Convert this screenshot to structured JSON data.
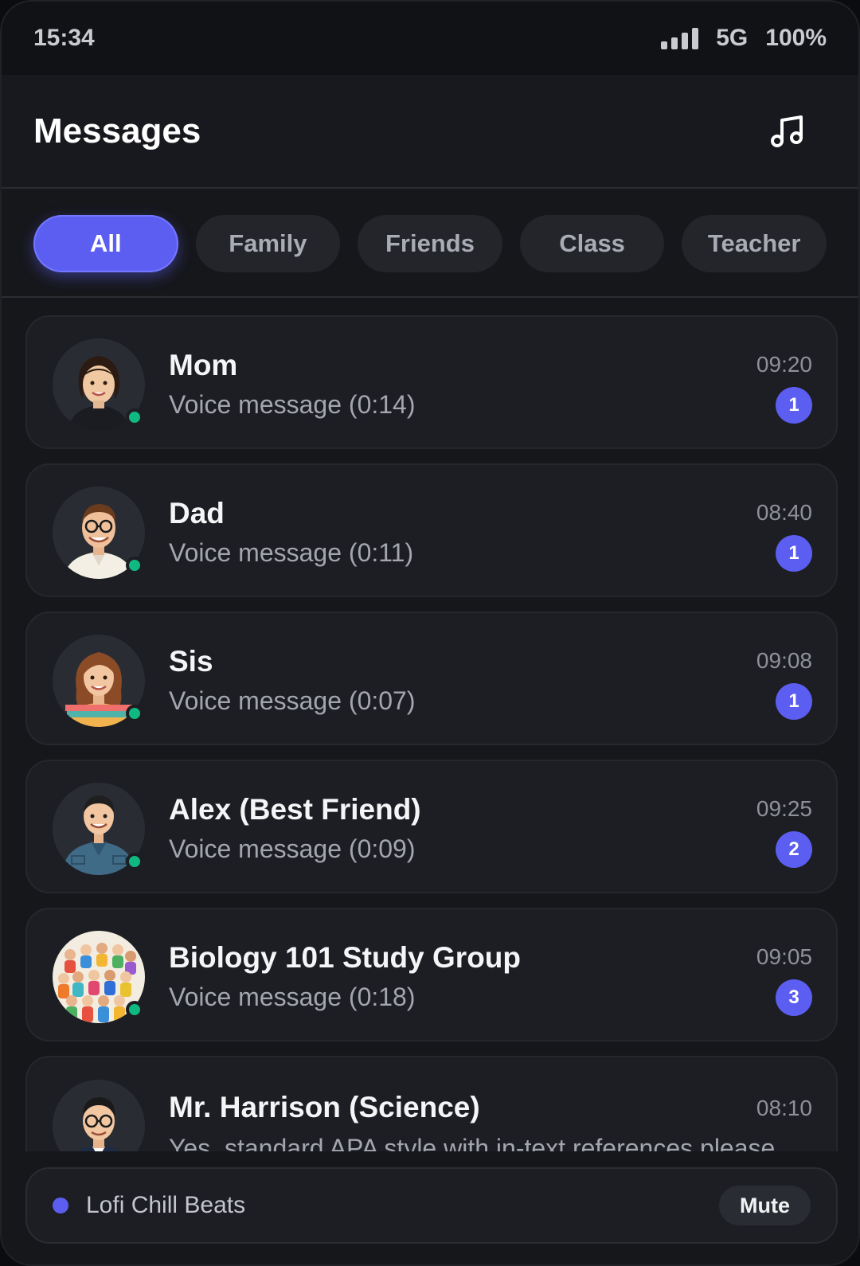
{
  "status": {
    "time": "15:34",
    "network": "5G",
    "battery": "100%"
  },
  "header": {
    "title": "Messages",
    "music_icon": "music-note-icon"
  },
  "tabs": [
    {
      "label": "All",
      "active": true
    },
    {
      "label": "Family",
      "active": false
    },
    {
      "label": "Friends",
      "active": false
    },
    {
      "label": "Class",
      "active": false
    },
    {
      "label": "Teacher",
      "active": false
    }
  ],
  "conversations": [
    {
      "name": "Mom",
      "preview": "Voice message (0:14)",
      "time": "09:20",
      "unread": "1",
      "online": true
    },
    {
      "name": "Dad",
      "preview": "Voice message (0:11)",
      "time": "08:40",
      "unread": "1",
      "online": true
    },
    {
      "name": "Sis",
      "preview": "Voice message (0:07)",
      "time": "09:08",
      "unread": "1",
      "online": true
    },
    {
      "name": "Alex (Best Friend)",
      "preview": "Voice message (0:09)",
      "time": "09:25",
      "unread": "2",
      "online": true
    },
    {
      "name": "Biology 101 Study Group",
      "preview": "Voice message (0:18)",
      "time": "09:05",
      "unread": "3",
      "online": true
    },
    {
      "name": "Mr. Harrison (Science)",
      "preview": "Yes, standard APA style with in-text references please.",
      "time": "08:10",
      "unread": "",
      "online": false
    }
  ],
  "player": {
    "track": "Lofi Chill Beats",
    "mute_label": "Mute"
  },
  "colors": {
    "accent": "#5b5ef0",
    "online": "#10b981",
    "background": "#16171b",
    "card": "#1d1e23"
  }
}
